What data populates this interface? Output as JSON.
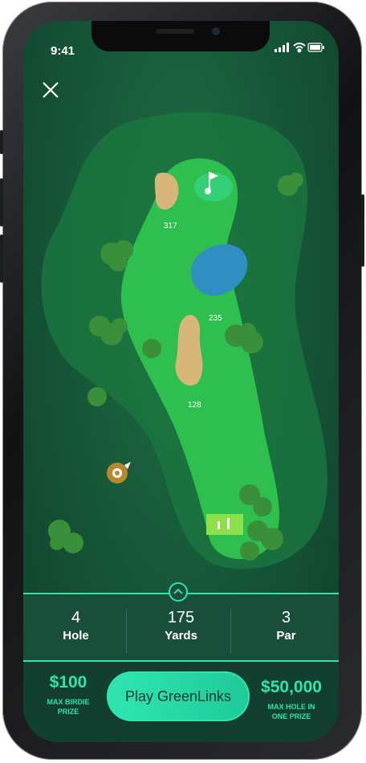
{
  "status_bar": {
    "time": "9:41"
  },
  "map": {
    "yardage_markers": [
      "317",
      "235",
      "128"
    ]
  },
  "hole_info": {
    "hole": {
      "value": "4",
      "label": "Hole"
    },
    "yards": {
      "value": "175",
      "label": "Yards"
    },
    "par": {
      "value": "3",
      "label": "Par"
    }
  },
  "prizes": {
    "left": {
      "amount": "$100",
      "label_line1": "MAX BIRDIE",
      "label_line2": "PRIZE"
    },
    "right": {
      "amount": "$50,000",
      "label_line1": "MAX HOLE IN",
      "label_line2": "ONE PRIZE"
    }
  },
  "cta": {
    "label": "Play GreenLinks"
  },
  "colors": {
    "accent": "#2ee6a8",
    "panel": "#194e3b",
    "fairway": "#2fbf4f",
    "water": "#2f8fc2",
    "sand": "#d8b67a"
  },
  "icons": [
    "close-icon",
    "flag-icon",
    "tee-icon",
    "compass-icon",
    "signal-icon",
    "wifi-icon",
    "battery-icon",
    "chevron-up-icon"
  ]
}
